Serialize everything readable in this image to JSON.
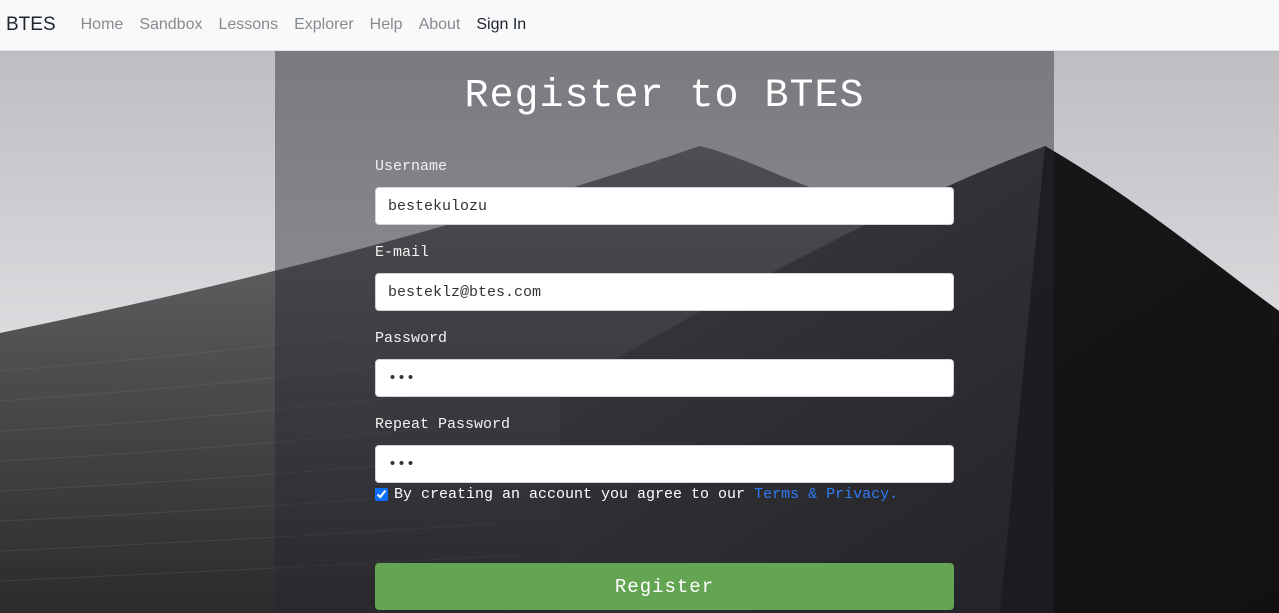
{
  "navbar": {
    "brand": "BTES",
    "links": [
      "Home",
      "Sandbox",
      "Lessons",
      "Explorer",
      "Help",
      "About",
      "Sign In"
    ]
  },
  "form": {
    "title": "Register to BTES",
    "username_label": "Username",
    "username_value": "bestekulozu",
    "email_label": "E-mail",
    "email_value": "besteklz@btes.com",
    "password_label": "Password",
    "password_value": "•••",
    "repeat_password_label": "Repeat Password",
    "repeat_password_value": "•••",
    "agree_text": "By creating an account you agree to our",
    "terms_link": "Terms & Privacy.",
    "agree_checked": true,
    "register_button": "Register"
  },
  "colors": {
    "register_button": "#64a553",
    "terms_link": "#2f7bf5",
    "navbar_bg": "#f8f9fa"
  }
}
